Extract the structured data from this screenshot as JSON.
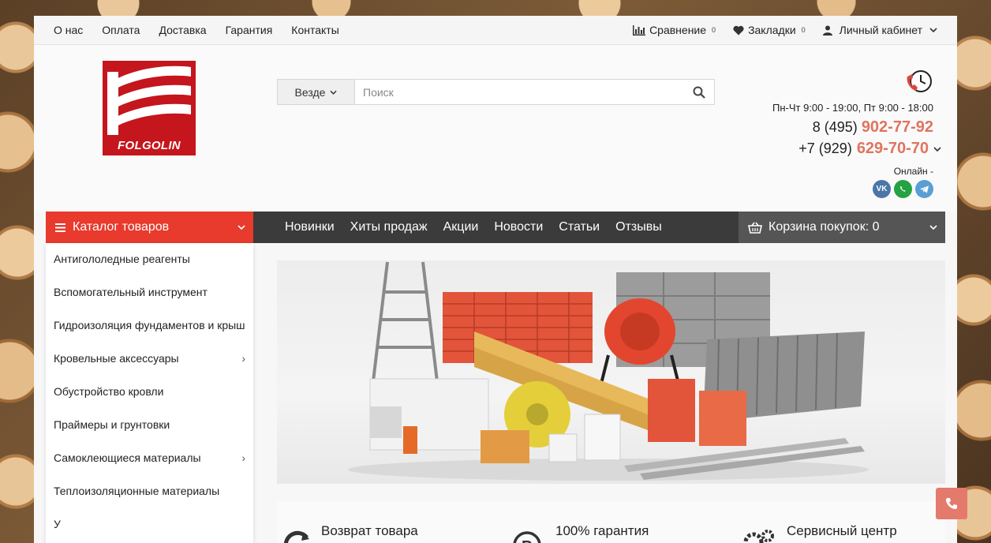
{
  "topbar": {
    "links": [
      "О нас",
      "Оплата",
      "Доставка",
      "Гарантия",
      "Контакты"
    ],
    "compare_label": "Сравнение",
    "compare_count": "0",
    "bookmarks_label": "Закладки",
    "bookmarks_count": "0",
    "account_label": "Личный кабинет"
  },
  "logo": {
    "text": "FOLGOLIN",
    "color": "#c4161c"
  },
  "search": {
    "scope": "Везде",
    "placeholder": "Поиск"
  },
  "contacts": {
    "hours": "Пн-Чт 9:00 - 19:00, Пт 9:00 - 18:00",
    "phone1_prefix": "8 (495)",
    "phone1_number": "902-77-92",
    "phone2_prefix": "+7 (929)",
    "phone2_number": "629-70-70",
    "online_label": "Онлайн -",
    "accent": "#e0745f"
  },
  "nav": {
    "catalog_label": "Каталог товаров",
    "links": [
      "Новинки",
      "Хиты продаж",
      "Акции",
      "Новости",
      "Статьи",
      "Отзывы"
    ],
    "cart_label": "Корзина покупок: 0",
    "catalog_color": "#e83a2d"
  },
  "sidebar": {
    "items": [
      "Антигололедные реагенты",
      "Вспомогательный инструмент",
      "Гидроизоляция фундаментов и крыш",
      "Кровельные аксессуары",
      "Обустройство кровли",
      "Праймеры и грунтовки",
      "Самоклеющиеся материалы",
      "Теплоизоляционные материалы",
      "У"
    ]
  },
  "features": {
    "items": [
      "Возврат товара",
      "100% гарантия",
      "Сервисный центр"
    ]
  }
}
